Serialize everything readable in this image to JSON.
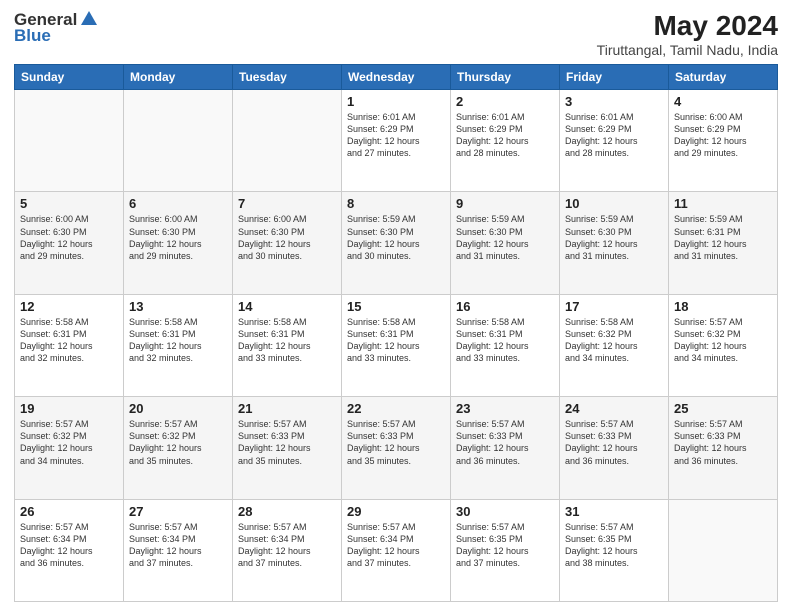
{
  "logo": {
    "general": "General",
    "blue": "Blue"
  },
  "title": "May 2024",
  "subtitle": "Tiruttangal, Tamil Nadu, India",
  "headers": [
    "Sunday",
    "Monday",
    "Tuesday",
    "Wednesday",
    "Thursday",
    "Friday",
    "Saturday"
  ],
  "weeks": [
    [
      {
        "day": "",
        "info": ""
      },
      {
        "day": "",
        "info": ""
      },
      {
        "day": "",
        "info": ""
      },
      {
        "day": "1",
        "info": "Sunrise: 6:01 AM\nSunset: 6:29 PM\nDaylight: 12 hours\nand 27 minutes."
      },
      {
        "day": "2",
        "info": "Sunrise: 6:01 AM\nSunset: 6:29 PM\nDaylight: 12 hours\nand 28 minutes."
      },
      {
        "day": "3",
        "info": "Sunrise: 6:01 AM\nSunset: 6:29 PM\nDaylight: 12 hours\nand 28 minutes."
      },
      {
        "day": "4",
        "info": "Sunrise: 6:00 AM\nSunset: 6:29 PM\nDaylight: 12 hours\nand 29 minutes."
      }
    ],
    [
      {
        "day": "5",
        "info": "Sunrise: 6:00 AM\nSunset: 6:30 PM\nDaylight: 12 hours\nand 29 minutes."
      },
      {
        "day": "6",
        "info": "Sunrise: 6:00 AM\nSunset: 6:30 PM\nDaylight: 12 hours\nand 29 minutes."
      },
      {
        "day": "7",
        "info": "Sunrise: 6:00 AM\nSunset: 6:30 PM\nDaylight: 12 hours\nand 30 minutes."
      },
      {
        "day": "8",
        "info": "Sunrise: 5:59 AM\nSunset: 6:30 PM\nDaylight: 12 hours\nand 30 minutes."
      },
      {
        "day": "9",
        "info": "Sunrise: 5:59 AM\nSunset: 6:30 PM\nDaylight: 12 hours\nand 31 minutes."
      },
      {
        "day": "10",
        "info": "Sunrise: 5:59 AM\nSunset: 6:30 PM\nDaylight: 12 hours\nand 31 minutes."
      },
      {
        "day": "11",
        "info": "Sunrise: 5:59 AM\nSunset: 6:31 PM\nDaylight: 12 hours\nand 31 minutes."
      }
    ],
    [
      {
        "day": "12",
        "info": "Sunrise: 5:58 AM\nSunset: 6:31 PM\nDaylight: 12 hours\nand 32 minutes."
      },
      {
        "day": "13",
        "info": "Sunrise: 5:58 AM\nSunset: 6:31 PM\nDaylight: 12 hours\nand 32 minutes."
      },
      {
        "day": "14",
        "info": "Sunrise: 5:58 AM\nSunset: 6:31 PM\nDaylight: 12 hours\nand 33 minutes."
      },
      {
        "day": "15",
        "info": "Sunrise: 5:58 AM\nSunset: 6:31 PM\nDaylight: 12 hours\nand 33 minutes."
      },
      {
        "day": "16",
        "info": "Sunrise: 5:58 AM\nSunset: 6:31 PM\nDaylight: 12 hours\nand 33 minutes."
      },
      {
        "day": "17",
        "info": "Sunrise: 5:58 AM\nSunset: 6:32 PM\nDaylight: 12 hours\nand 34 minutes."
      },
      {
        "day": "18",
        "info": "Sunrise: 5:57 AM\nSunset: 6:32 PM\nDaylight: 12 hours\nand 34 minutes."
      }
    ],
    [
      {
        "day": "19",
        "info": "Sunrise: 5:57 AM\nSunset: 6:32 PM\nDaylight: 12 hours\nand 34 minutes."
      },
      {
        "day": "20",
        "info": "Sunrise: 5:57 AM\nSunset: 6:32 PM\nDaylight: 12 hours\nand 35 minutes."
      },
      {
        "day": "21",
        "info": "Sunrise: 5:57 AM\nSunset: 6:33 PM\nDaylight: 12 hours\nand 35 minutes."
      },
      {
        "day": "22",
        "info": "Sunrise: 5:57 AM\nSunset: 6:33 PM\nDaylight: 12 hours\nand 35 minutes."
      },
      {
        "day": "23",
        "info": "Sunrise: 5:57 AM\nSunset: 6:33 PM\nDaylight: 12 hours\nand 36 minutes."
      },
      {
        "day": "24",
        "info": "Sunrise: 5:57 AM\nSunset: 6:33 PM\nDaylight: 12 hours\nand 36 minutes."
      },
      {
        "day": "25",
        "info": "Sunrise: 5:57 AM\nSunset: 6:33 PM\nDaylight: 12 hours\nand 36 minutes."
      }
    ],
    [
      {
        "day": "26",
        "info": "Sunrise: 5:57 AM\nSunset: 6:34 PM\nDaylight: 12 hours\nand 36 minutes."
      },
      {
        "day": "27",
        "info": "Sunrise: 5:57 AM\nSunset: 6:34 PM\nDaylight: 12 hours\nand 37 minutes."
      },
      {
        "day": "28",
        "info": "Sunrise: 5:57 AM\nSunset: 6:34 PM\nDaylight: 12 hours\nand 37 minutes."
      },
      {
        "day": "29",
        "info": "Sunrise: 5:57 AM\nSunset: 6:34 PM\nDaylight: 12 hours\nand 37 minutes."
      },
      {
        "day": "30",
        "info": "Sunrise: 5:57 AM\nSunset: 6:35 PM\nDaylight: 12 hours\nand 37 minutes."
      },
      {
        "day": "31",
        "info": "Sunrise: 5:57 AM\nSunset: 6:35 PM\nDaylight: 12 hours\nand 38 minutes."
      },
      {
        "day": "",
        "info": ""
      }
    ]
  ]
}
